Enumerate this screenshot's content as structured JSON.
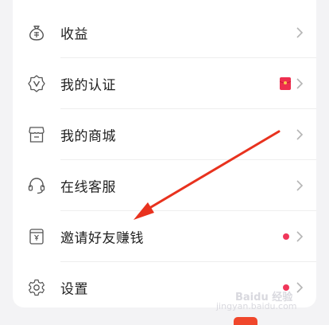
{
  "menu": {
    "items": [
      {
        "label": "收益",
        "icon": "money-bag-icon"
      },
      {
        "label": "我的认证",
        "icon": "certified-badge-icon",
        "badge": "red-envelope-icon"
      },
      {
        "label": "我的商城",
        "icon": "store-icon"
      },
      {
        "label": "在线客服",
        "icon": "headset-icon"
      },
      {
        "label": "邀请好友赚钱",
        "icon": "yuan-bag-icon",
        "badge": "red-dot"
      },
      {
        "label": "设置",
        "icon": "gear-icon",
        "badge": "red-dot"
      }
    ]
  },
  "watermark": {
    "line1": "Baidu 经验",
    "line2": "jingyan.baidu.com"
  },
  "colors": {
    "badge": "#f0375a",
    "arrow": "#e8321e",
    "icon": "#555555"
  }
}
